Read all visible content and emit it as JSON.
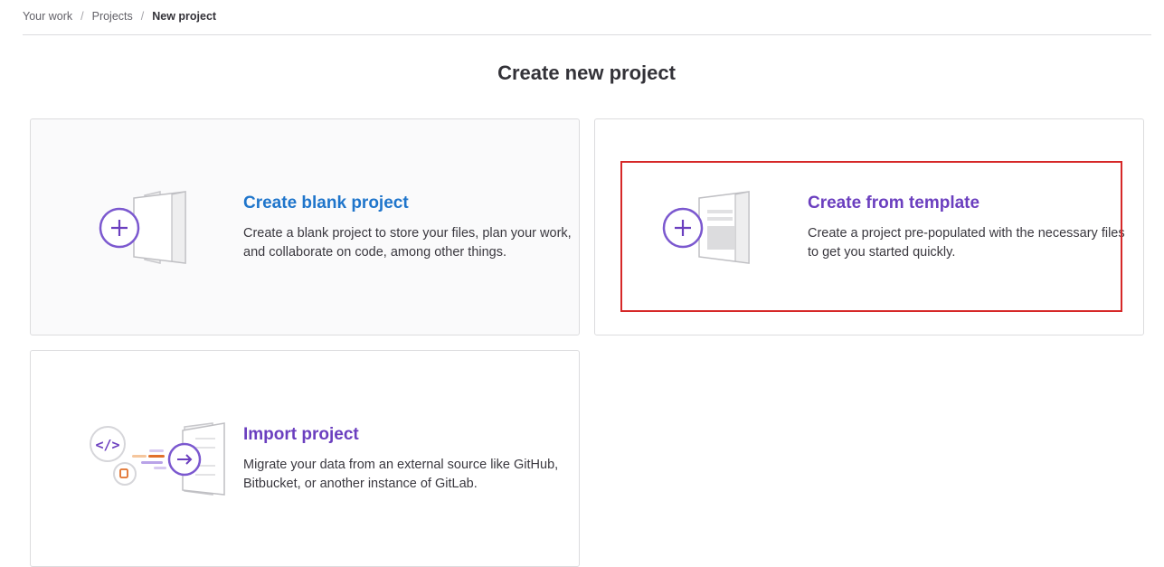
{
  "breadcrumb": {
    "items": [
      "Your work",
      "Projects"
    ],
    "separator": "/",
    "current": "New project"
  },
  "page_title": "Create new project",
  "cards": {
    "blank": {
      "title": "Create blank project",
      "description": "Create a blank project to store your files, plan your work, and collaborate on code, among other things.",
      "icon": "document-plus-icon"
    },
    "template": {
      "title": "Create from template",
      "description": "Create a project pre-populated with the necessary files to get you started quickly.",
      "icon": "template-plus-icon"
    },
    "import": {
      "title": "Import project",
      "description": "Migrate your data from an external source like GitHub, Bitbucket, or another instance of GitLab.",
      "icon": "import-arrow-icon"
    }
  },
  "colors": {
    "accent_purple": "#6b3fbf",
    "link_blue": "#1f75cb",
    "highlight_red": "#d62828"
  }
}
